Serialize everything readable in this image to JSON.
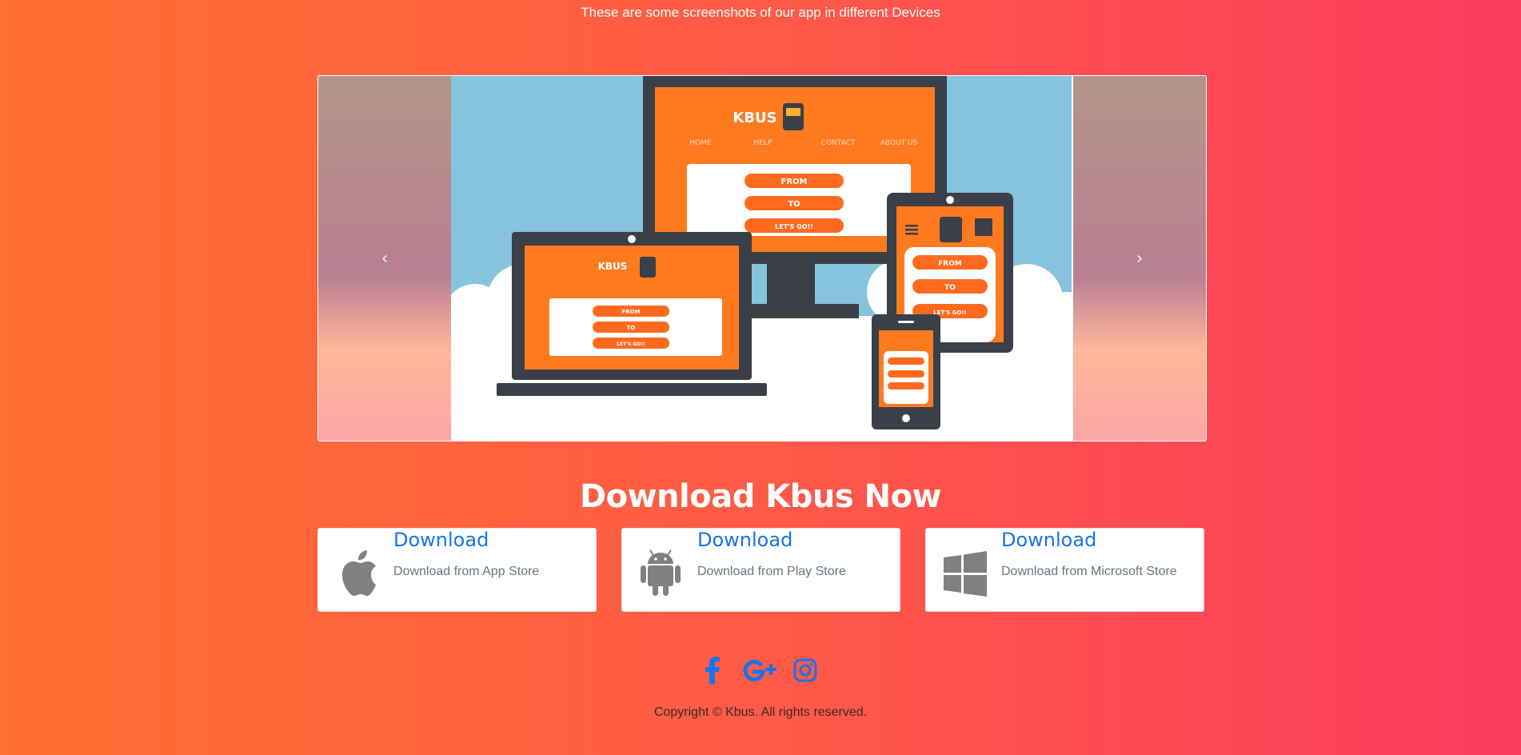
{
  "header": {
    "subtitle": "These are some screenshots of our app in different Devices"
  },
  "carousel": {
    "prev_icon": "chevron-left-icon",
    "next_icon": "chevron-right-icon",
    "prev_label": "‹",
    "next_label": "›",
    "mockup": {
      "brand": "KBUS",
      "nav": [
        "HOME",
        "HELP",
        "CONTACT",
        "ABOUT US"
      ],
      "buttons": [
        "FROM",
        "TO",
        "LET'S GO!!"
      ]
    }
  },
  "download": {
    "heading": "Download Kbus Now",
    "cards": [
      {
        "title": "Download",
        "desc": "Download from App Store",
        "icon": "apple-icon"
      },
      {
        "title": "Download",
        "desc": "Download from Play Store",
        "icon": "android-icon"
      },
      {
        "title": "Download",
        "desc": "Download from Microsoft Store",
        "icon": "windows-icon"
      }
    ]
  },
  "social": {
    "icons": [
      "facebook-icon",
      "google-plus-icon",
      "instagram-icon"
    ]
  },
  "footer": {
    "copyright": "Copyright © Kbus. All rights reserved."
  },
  "colors": {
    "link": "#1a73e8",
    "bg_start": "#ff6f2f",
    "bg_end": "#fb3b5e",
    "social": "#1a73e8"
  }
}
